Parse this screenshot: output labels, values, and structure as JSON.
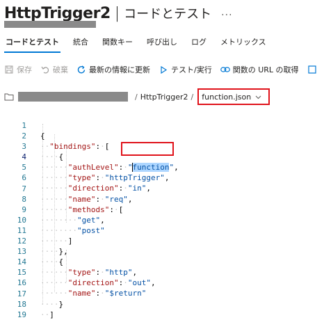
{
  "header": {
    "title": "HttpTrigger2",
    "separator": "|",
    "subtitle": "コードとテスト",
    "more": "···"
  },
  "tabs": [
    {
      "label": "コードとテスト",
      "active": true
    },
    {
      "label": "統合",
      "active": false
    },
    {
      "label": "関数キー",
      "active": false
    },
    {
      "label": "呼び出し",
      "active": false
    },
    {
      "label": "ログ",
      "active": false
    },
    {
      "label": "メトリックス",
      "active": false
    }
  ],
  "toolbar": {
    "save": {
      "label": "保存",
      "icon": "save-icon",
      "enabled": false
    },
    "discard": {
      "label": "破棄",
      "icon": "undo-icon",
      "enabled": false
    },
    "refresh": {
      "label": "最新の情報に更新",
      "icon": "refresh-icon",
      "enabled": true
    },
    "test": {
      "label": "テスト/実行",
      "icon": "play-icon",
      "enabled": true
    },
    "get_url": {
      "label": "関数の URL の取得",
      "icon": "link-icon",
      "enabled": true
    }
  },
  "breadcrumb": {
    "separator": "/",
    "function": "HttpTrigger2",
    "file": "function.json"
  },
  "editor": {
    "line_numbers": [
      "1",
      "2",
      "3",
      "4",
      "5",
      "6",
      "7",
      "8",
      "9",
      "10",
      "11",
      "12",
      "13",
      "14",
      "15",
      "16",
      "17",
      "18",
      "19"
    ],
    "current_line": "4",
    "bindings_key": "\"bindings\"",
    "auth_key": "\"authLevel\"",
    "auth_value": "function",
    "type_key": "\"type\"",
    "type_value_1": "\"httpTrigger\"",
    "direction_key": "\"direction\"",
    "direction_value_1": "\"in\"",
    "name_key": "\"name\"",
    "name_value_1": "\"req\"",
    "methods_key": "\"methods\"",
    "method_get": "\"get\"",
    "method_post": "\"post\"",
    "type_value_2": "\"http\"",
    "direction_value_2": "\"out\"",
    "name_value_2": "\"$return\""
  },
  "colors": {
    "accent": "#0078d4",
    "highlight_box": "#e0121a",
    "json_key": "#a31515",
    "json_string": "#0451a5",
    "line_number": "#237893",
    "selection": "#add6ff"
  }
}
